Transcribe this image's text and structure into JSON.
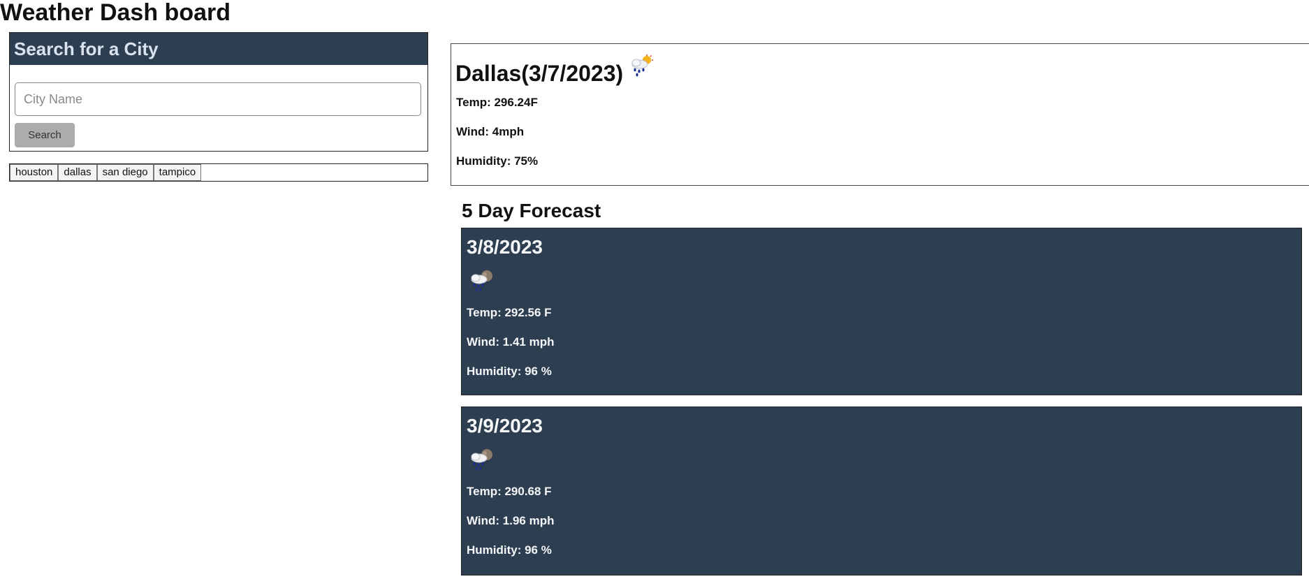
{
  "page_title": "Weather Dash board",
  "search": {
    "header": "Search for a City",
    "placeholder": "City Name",
    "button_label": "Search"
  },
  "history": [
    "houston",
    "dallas",
    "san diego",
    "tampico"
  ],
  "current": {
    "city_date": "Dallas(3/7/2023)",
    "icon": "cloud-sun-rain-icon",
    "temp": "Temp: 296.24F",
    "wind": "Wind: 4mph",
    "humidity": "Humidity: 75%"
  },
  "forecast": {
    "heading": "5 Day Forecast",
    "days": [
      {
        "date": "3/8/2023",
        "icon": "night-cloud-rain-icon",
        "temp": "Temp: 292.56 F",
        "wind": "Wind: 1.41 mph",
        "humidity": "Humidity: 96 %"
      },
      {
        "date": "3/9/2023",
        "icon": "night-cloud-rain-icon",
        "temp": "Temp: 290.68 F",
        "wind": "Wind: 1.96 mph",
        "humidity": "Humidity: 96 %"
      }
    ]
  },
  "colors": {
    "panel_dark": "#2e3e51",
    "search_button": "#acacac"
  }
}
